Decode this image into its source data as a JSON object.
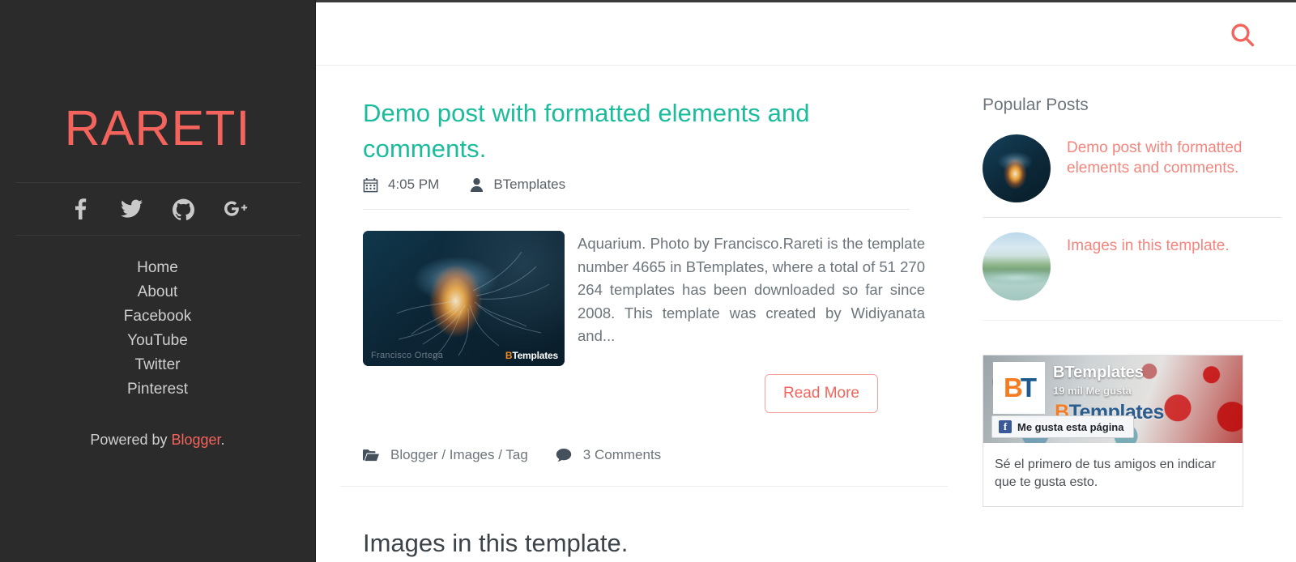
{
  "site": {
    "title": "RARETI",
    "powered_prefix": "Powered by ",
    "powered_link": "Blogger",
    "powered_suffix": "."
  },
  "social": [
    {
      "name": "facebook-icon",
      "label": "Facebook"
    },
    {
      "name": "twitter-icon",
      "label": "Twitter"
    },
    {
      "name": "github-icon",
      "label": "GitHub"
    },
    {
      "name": "googleplus-icon",
      "label": "Google Plus"
    }
  ],
  "nav": [
    {
      "label": "Home"
    },
    {
      "label": "About"
    },
    {
      "label": "Facebook"
    },
    {
      "label": "YouTube"
    },
    {
      "label": "Twitter"
    },
    {
      "label": "Pinterest"
    }
  ],
  "header": {
    "search_label": "Search"
  },
  "post": {
    "title": "Demo post with formatted elements and comments.",
    "time": "4:05 PM",
    "author": "BTemplates",
    "excerpt": "Aquarium. Photo by Francisco.Rareti is the template number 4665 in BTemplates, where a total of 51 270 264 templates has been downloaded so far since 2008. This template was created by Widiyanata and...",
    "read_more": "Read More",
    "categories": "Blogger / Images / Tag",
    "comments": "3 Comments",
    "thumb_credit": "Francisco Ortega",
    "thumb_watermark_b": "B",
    "thumb_watermark_rest": "Templates"
  },
  "next_post": {
    "title": "Images in this template."
  },
  "sidebar": {
    "popular_posts_title": "Popular Posts",
    "popular_posts": [
      {
        "title": "Demo post with formatted elements and comments.",
        "thumb": "jelly"
      },
      {
        "title": "Images in this template.",
        "thumb": "river"
      }
    ]
  },
  "fb_widget": {
    "page_name": "BTemplates",
    "likes": "19 mil Me gusta",
    "brand_b": "B",
    "brand_rest": "Templates",
    "avatar_b": "B",
    "avatar_t": "T",
    "like_button": "Me gusta esta página",
    "like_f": "f",
    "body_text": "Sé el primero de tus amigos en indicar que te gusta esto."
  },
  "colors": {
    "accent_red": "#f4645c",
    "accent_teal": "#1bbc9b",
    "sidebar_bg": "#2b2b2b",
    "text_gray": "#6d757c"
  }
}
